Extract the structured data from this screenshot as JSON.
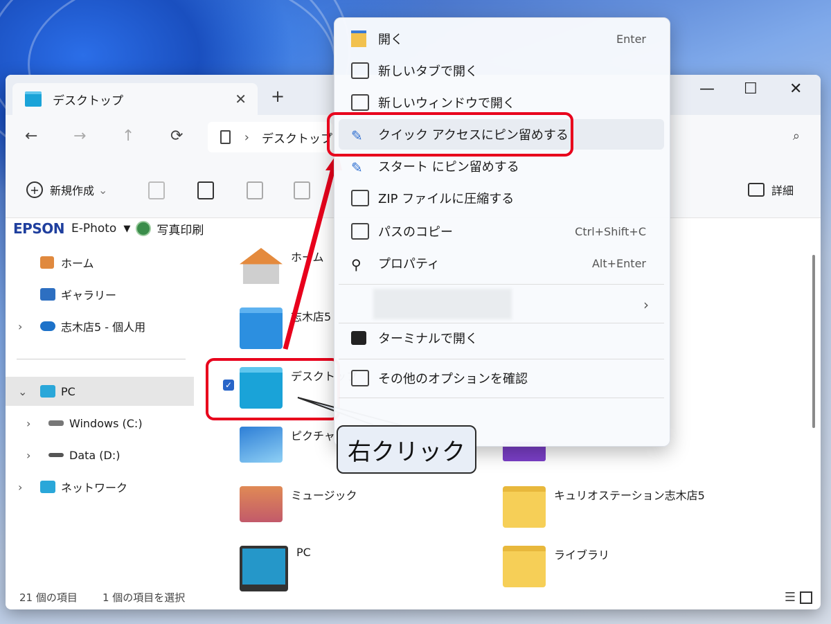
{
  "window": {
    "tab_title": "デスクトップ",
    "tab_close": "✕",
    "new_tab": "+",
    "minimize": "—",
    "maximize": "☐",
    "close": "✕"
  },
  "nav": {
    "back": "←",
    "forward": "→",
    "up": "↑",
    "refresh": "⟳",
    "breadcrumb_sep": "›",
    "breadcrumb": "デスクトップ",
    "search_icon": "⌕"
  },
  "toolbar": {
    "new_label": "新規作成",
    "new_caret": "⌄",
    "details_label": "詳細"
  },
  "epson_bar": {
    "brand": "EPSON",
    "app": "E-Photo",
    "caret": "▼",
    "print": "写真印刷"
  },
  "sidebar": {
    "items": [
      {
        "label": "ホーム",
        "icon": "home-icon"
      },
      {
        "label": "ギャラリー",
        "icon": "gallery-icon"
      },
      {
        "label": "志木店5 - 個人用",
        "icon": "cloud-icon"
      },
      {
        "label": "PC",
        "icon": "pc-icon"
      },
      {
        "label": "Windows (C:)",
        "icon": "drive-icon"
      },
      {
        "label": "Data (D:)",
        "icon": "drive-icon"
      },
      {
        "label": "ネットワーク",
        "icon": "network-icon"
      }
    ],
    "chevron_collapsed": "›",
    "chevron_expanded": "⌄"
  },
  "content": {
    "items": [
      {
        "label": "ホーム",
        "icon": "home-icon"
      },
      {
        "label": "志木店5",
        "icon": "cloud-folder-icon"
      },
      {
        "label": "デスクトップ",
        "icon": "desktop-folder-icon"
      },
      {
        "label": "ピクチャ",
        "icon": "pictures-folder-icon"
      },
      {
        "label": "ミュージック",
        "icon": "music-folder-icon"
      },
      {
        "label": "PC",
        "icon": "monitor-icon"
      },
      {
        "label": "キュリオステーション志木店5",
        "icon": "folder-icon"
      },
      {
        "label": "ライブラリ",
        "icon": "library-folder-icon"
      }
    ],
    "checkmark": "✓"
  },
  "status": {
    "count": "21 個の項目",
    "selected": "1 個の項目を選択"
  },
  "context_menu": {
    "items": [
      {
        "label": "開く",
        "shortcut": "Enter",
        "icon": "open-folder-icon"
      },
      {
        "label": "新しいタブで開く",
        "shortcut": "",
        "icon": "new-tab-icon"
      },
      {
        "label": "新しいウィンドウで開く",
        "shortcut": "",
        "icon": "new-window-icon"
      },
      {
        "label": "クイック アクセスにピン留めする",
        "shortcut": "",
        "icon": "pin-icon"
      },
      {
        "label": "スタート にピン留めする",
        "shortcut": "",
        "icon": "pin-icon"
      },
      {
        "label": "ZIP ファイルに圧縮する",
        "shortcut": "",
        "icon": "zip-icon"
      },
      {
        "label": "パスのコピー",
        "shortcut": "Ctrl+Shift+C",
        "icon": "copy-path-icon"
      },
      {
        "label": "プロパティ",
        "shortcut": "Alt+Enter",
        "icon": "wrench-icon"
      },
      {
        "label": "ターミナルで開く",
        "shortcut": "",
        "icon": "terminal-icon"
      },
      {
        "label": "その他のオプションを確認",
        "shortcut": "",
        "icon": "more-options-icon"
      }
    ],
    "submenu_arrow": "›"
  },
  "annotation": {
    "callout": "右クリック"
  },
  "colors": {
    "highlight_red": "#e8001c",
    "folder_blue": "#1aa3d8",
    "folder_yellow": "#f6cf57"
  }
}
